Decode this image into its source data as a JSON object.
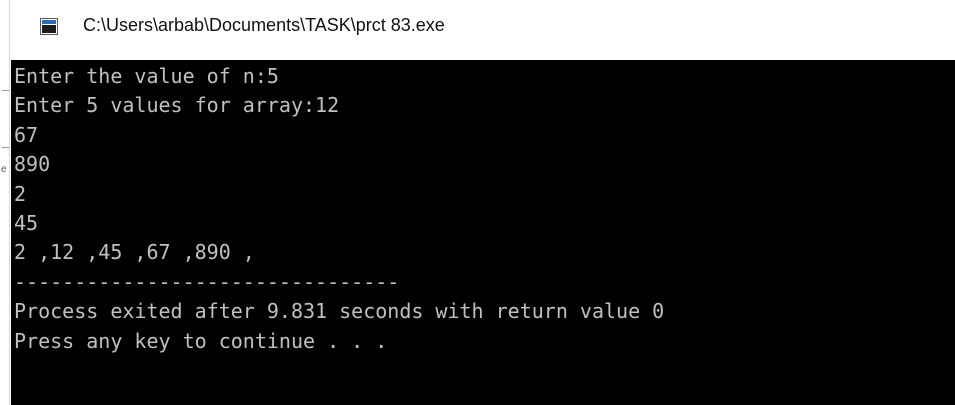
{
  "window": {
    "title": "C:\\Users\\arbab\\Documents\\TASK\\prct 83.exe",
    "icon": "console-window-icon"
  },
  "left_strip": {
    "glyph": "e"
  },
  "console": {
    "lines": [
      "Enter the value of n:5",
      "Enter 5 values for array:12",
      "67",
      "890",
      "2",
      "45",
      "2 ,12 ,45 ,67 ,890 ,",
      "--------------------------------",
      "Process exited after 9.831 seconds with return value 0",
      "Press any key to continue . . ."
    ],
    "background": "#000000",
    "foreground": "#c0c0c0"
  }
}
